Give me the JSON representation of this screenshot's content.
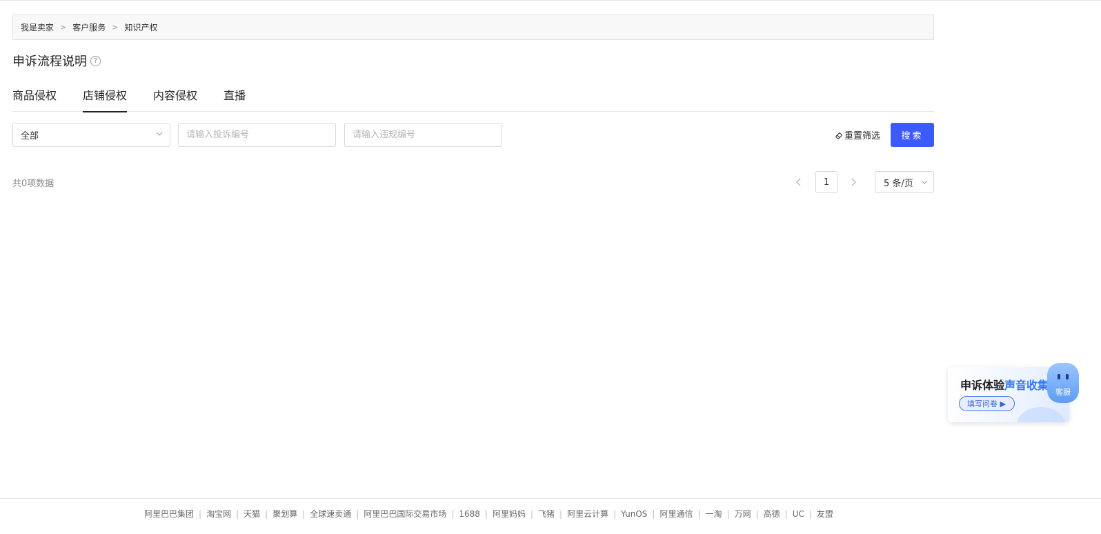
{
  "breadcrumb": {
    "items": [
      "我是卖家",
      "客户服务",
      "知识产权"
    ],
    "separator": ">"
  },
  "page_title": "申诉流程说明",
  "help_icon_glyph": "?",
  "tabs": [
    {
      "label": "商品侵权",
      "active": false
    },
    {
      "label": "店铺侵权",
      "active": true
    },
    {
      "label": "内容侵权",
      "active": false
    },
    {
      "label": "直播",
      "active": false
    }
  ],
  "filters": {
    "select_value": "全部",
    "complaint_placeholder": "请输入投诉编号",
    "violation_placeholder": "请输入违规编号",
    "reset_label": "重置筛选",
    "search_label": "搜索"
  },
  "result": {
    "total_text": "共0项数据"
  },
  "pagination": {
    "current_page": "1",
    "page_size": "5 条/页"
  },
  "footer_links": [
    "阿里巴巴集团",
    "淘宝网",
    "天猫",
    "聚划算",
    "全球速卖通",
    "阿里巴巴国际交易市场",
    "1688",
    "阿里妈妈",
    "飞猪",
    "阿里云计算",
    "YunOS",
    "阿里通信",
    "一淘",
    "万网",
    "高德",
    "UC",
    "友盟"
  ],
  "footer_separator": "|",
  "survey": {
    "title_prefix": "申诉体验",
    "title_highlight": "声音收集",
    "button_label": "填写问卷 ▶"
  },
  "customer_service": {
    "label": "客服"
  },
  "colors": {
    "primary": "#3d5afe",
    "highlight": "#3474f5"
  }
}
